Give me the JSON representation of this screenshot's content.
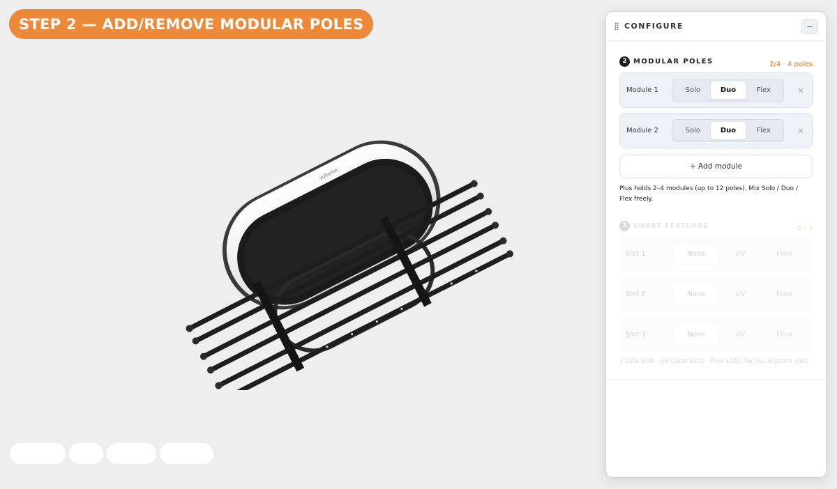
{
  "step_banner": {
    "label": "STEP 2 — ADD/REMOVE MODULAR POLES"
  },
  "viewer": {
    "brand_text": "yuhome"
  },
  "configure": {
    "title": "CONFIGURE",
    "collapse_label": "–",
    "modular": {
      "step": "2",
      "title": "MODULAR POLES",
      "count": "2/4 · 4 poles",
      "modules": [
        {
          "label": "Module 1",
          "options": [
            "Solo",
            "Duo",
            "Flex"
          ],
          "selected": "Duo"
        },
        {
          "label": "Module 2",
          "options": [
            "Solo",
            "Duo",
            "Flex"
          ],
          "selected": "Duo"
        }
      ],
      "remove_label": "×",
      "add_label": "+ Add module",
      "hint": "Plus holds 2–4 modules (up to 12 poles). Mix Solo / Duo / Flex freely."
    },
    "smart": {
      "step": "3",
      "title": "SMART FEATURES",
      "count": "0 / 3",
      "slots": [
        {
          "label": "Slot 1",
          "options": [
            "None",
            "UV",
            "Flow"
          ],
          "selected": "None"
        },
        {
          "label": "Slot 2",
          "options": [
            "None",
            "UV",
            "Flow"
          ],
          "selected": "None"
        },
        {
          "label": "Slot 3",
          "options": [
            "None",
            "UV",
            "Flow"
          ],
          "selected": "None"
        }
      ],
      "footnote": "3 base slots · UV Clean $100 · Flow $220. No two adjacent slots"
    }
  },
  "colors": {
    "accent": "#ec8a3a",
    "count_orange": "#e07b2d"
  }
}
